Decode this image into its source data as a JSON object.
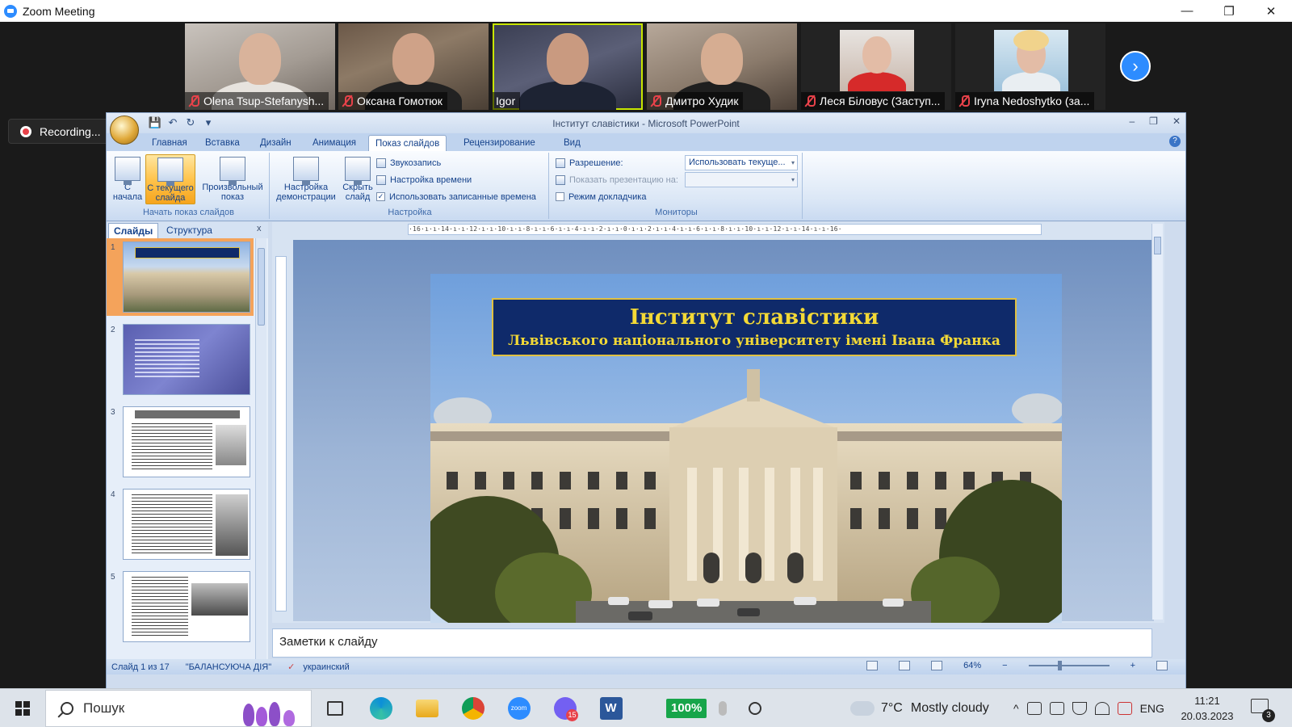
{
  "zoom": {
    "title": "Zoom Meeting",
    "window_controls": {
      "minimize": "—",
      "restore": "❐",
      "close": "✕"
    },
    "recording": "Recording...",
    "next_arrow": "›",
    "participants": [
      {
        "name": "Olena Tsup-Stefanysh...",
        "muted": true
      },
      {
        "name": "Оксана Гомотюк",
        "muted": true
      },
      {
        "name": "Igor",
        "muted": false,
        "active_speaker": true
      },
      {
        "name": "Дмитро Худик",
        "muted": true
      },
      {
        "name": "Леся Біловус (Заступ...",
        "muted": true
      },
      {
        "name": "Iryna Nedoshytko (за...",
        "muted": true
      }
    ]
  },
  "ppt": {
    "window_title": "Інститут славістики - Microsoft PowerPoint",
    "window_controls": {
      "minimize": "–",
      "restore": "❐",
      "close": "✕"
    },
    "qat": {
      "save": "💾",
      "undo": "↶",
      "redo": "↻",
      "more": "▾"
    },
    "help": "?",
    "tabs": [
      "Главная",
      "Вставка",
      "Дизайн",
      "Анимация",
      "Показ слайдов",
      "Рецензирование",
      "Вид"
    ],
    "active_tab": "Показ слайдов",
    "ribbon": {
      "start_group": {
        "label": "Начать показ слайдов",
        "buttons": [
          "С начала",
          "С текущего слайда",
          "Произвольный показ"
        ]
      },
      "setup_group": {
        "label": "Настройка",
        "buttons": [
          "Настройка демонстрации",
          "Скрыть слайд"
        ],
        "small": [
          "Звукозапись",
          "Настройка времени",
          "Использовать записанные времена"
        ],
        "use_timings_checked": true,
        "check_mark": "✓"
      },
      "monitors_group": {
        "label": "Мониторы",
        "resolution_label": "Разрешение:",
        "resolution_value": "Использовать текуще...",
        "show_on_label": "Показать презентацию на:",
        "show_on_value": "",
        "combo_arrow": "▾",
        "presenter_view": "Режим докладчика",
        "presenter_checked": false
      }
    },
    "pane": {
      "tabs": [
        "Слайды",
        "Структура"
      ],
      "close": "x",
      "thumbnails": [
        {
          "num": "1",
          "selected": true
        },
        {
          "num": "2",
          "selected": false
        },
        {
          "num": "3",
          "selected": false
        },
        {
          "num": "4",
          "selected": false
        },
        {
          "num": "5",
          "selected": false
        }
      ]
    },
    "ruler_text": "·16·ı·ı·14·ı·ı·12·ı·ı·10·ı·ı·8·ı·ı·6·ı·ı·4·ı·ı·2·ı·ı·0·ı·ı·2·ı·ı·4·ı·ı·6·ı·ı·8·ı·ı·10·ı·ı·12·ı·ı·14·ı·ı·16·",
    "slide": {
      "title_line1": "Інститут славістики",
      "title_line2": "Львівського національного університету імені Івана Франка"
    },
    "notes_placeholder": "Заметки к слайду",
    "status": {
      "slide_info": "Слайд 1 из 17",
      "theme": "\"БАЛАНСУЮЧА ДІЯ\"",
      "language": "украинский",
      "zoom": "64%",
      "zoom_minus": "−",
      "zoom_plus": "+"
    }
  },
  "taskbar": {
    "search_placeholder": "Пошук",
    "battery": "100%",
    "pinned": [
      "task-view",
      "edge",
      "file-explorer",
      "chrome",
      "zoom",
      "viber",
      "word"
    ],
    "viber_badge": "15",
    "zoom_label": "zoom",
    "word_label": "W",
    "weather_temp": "7°C",
    "weather_text": "Mostly cloudy",
    "tray_up": "^",
    "language": "ENG",
    "time": "11:21",
    "date": "20.03.2023",
    "notifications": "3"
  }
}
